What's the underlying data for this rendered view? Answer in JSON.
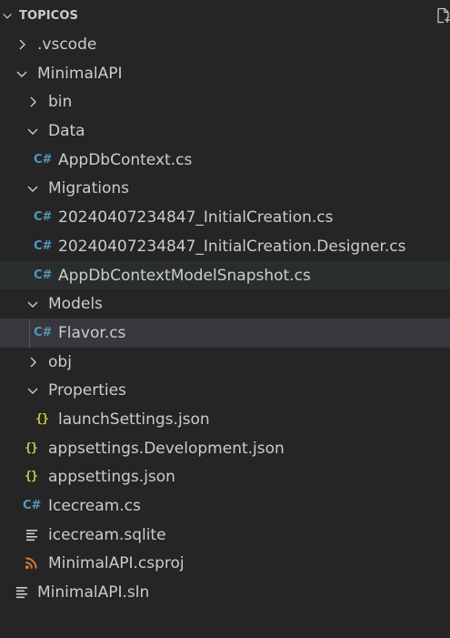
{
  "explorer": {
    "section_title": "TOPICOS",
    "new_file_icon": "new-file-icon"
  },
  "tree": [
    {
      "label": ".vscode",
      "type": "folder",
      "expanded": false
    },
    {
      "label": "MinimalAPI",
      "type": "folder",
      "expanded": true
    },
    {
      "label": "bin",
      "type": "folder",
      "expanded": false
    },
    {
      "label": "Data",
      "type": "folder",
      "expanded": true
    },
    {
      "label": "AppDbContext.cs",
      "type": "csharp"
    },
    {
      "label": "Migrations",
      "type": "folder",
      "expanded": true
    },
    {
      "label": "20240407234847_InitialCreation.cs",
      "type": "csharp"
    },
    {
      "label": "20240407234847_InitialCreation.Designer.cs",
      "type": "csharp"
    },
    {
      "label": "AppDbContextModelSnapshot.cs",
      "type": "csharp",
      "state": "hover"
    },
    {
      "label": "Models",
      "type": "folder",
      "expanded": true
    },
    {
      "label": "Flavor.cs",
      "type": "csharp",
      "state": "selected"
    },
    {
      "label": "obj",
      "type": "folder",
      "expanded": false
    },
    {
      "label": "Properties",
      "type": "folder",
      "expanded": true
    },
    {
      "label": "launchSettings.json",
      "type": "json"
    },
    {
      "label": "appsettings.Development.json",
      "type": "json"
    },
    {
      "label": "appsettings.json",
      "type": "json"
    },
    {
      "label": "Icecream.cs",
      "type": "csharp"
    },
    {
      "label": "icecream.sqlite",
      "type": "text"
    },
    {
      "label": "MinimalAPI.csproj",
      "type": "rss"
    },
    {
      "label": "MinimalAPI.sln",
      "type": "text"
    }
  ],
  "icon_glyphs": {
    "csharp": "C#",
    "json": "{}"
  },
  "colors": {
    "background": "#252526",
    "hover_row": "#2a2d2e",
    "selected_row": "#37373d",
    "csharp_icon": "#519aba",
    "json_icon": "#cbcb41",
    "rss_icon": "#e37933",
    "text": "#cccccc"
  }
}
